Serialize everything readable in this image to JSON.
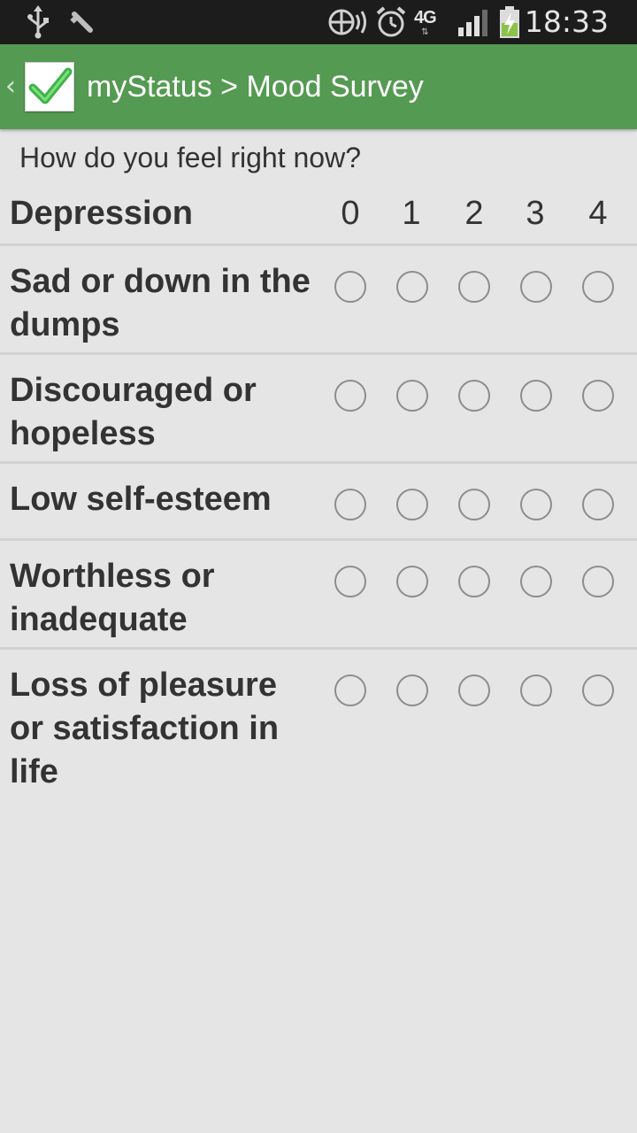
{
  "status_bar": {
    "time": "18:33",
    "network": "4G",
    "network_sub": "LTE",
    "icons": [
      "usb-icon",
      "tool-icon",
      "sync-icon",
      "alarm-icon",
      "network-4g-icon",
      "signal-icon",
      "battery-charging-icon"
    ],
    "battery_color": "#8bc34a"
  },
  "action_bar": {
    "title": "myStatus > Mood Survey",
    "color": "#559a52"
  },
  "survey": {
    "prompt": "How do you feel right now?",
    "category": "Depression",
    "scale": [
      "0",
      "1",
      "2",
      "3",
      "4"
    ],
    "items": [
      {
        "label": "Sad or down in the dumps",
        "selected": null
      },
      {
        "label": "Discouraged or hopeless",
        "selected": null
      },
      {
        "label": "Low self-esteem",
        "selected": null
      },
      {
        "label": "Worthless or inadequate",
        "selected": null
      },
      {
        "label": "Loss of pleasure or satisfaction in life",
        "selected": null
      }
    ]
  }
}
